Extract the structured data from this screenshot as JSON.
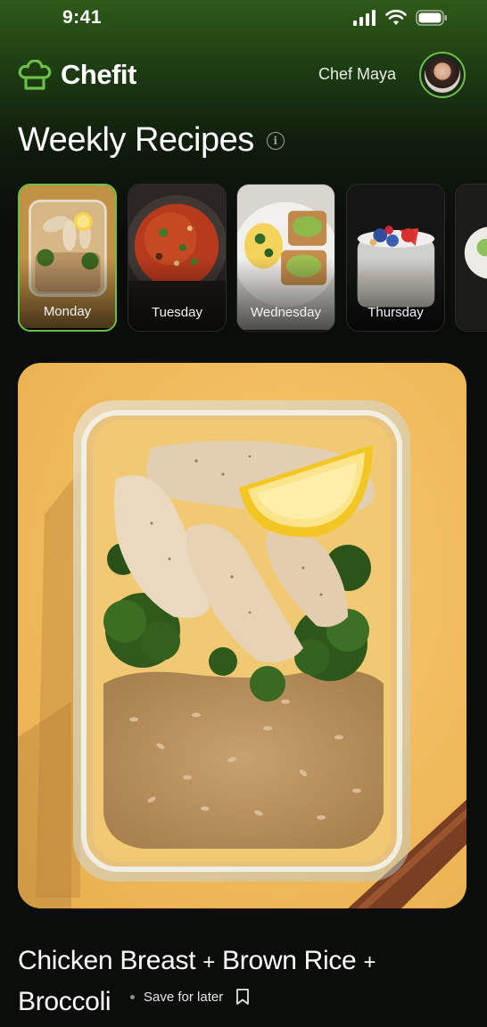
{
  "status_bar": {
    "time": "9:41"
  },
  "header": {
    "app_name": "Chefit",
    "user_name": "Chef Maya"
  },
  "section": {
    "title": "Weekly Recipes"
  },
  "days": [
    {
      "label": "Monday",
      "selected": true
    },
    {
      "label": "Tuesday",
      "selected": false
    },
    {
      "label": "Wednesday",
      "selected": false
    },
    {
      "label": "Thursday",
      "selected": false
    },
    {
      "label": "",
      "selected": false
    }
  ],
  "recipe": {
    "line1_part1": "Chicken Breast",
    "plus1": "+",
    "line1_part2": "Brown Rice",
    "plus2": "+",
    "line2": "Broccoli",
    "save_label": "Save for later"
  },
  "colors": {
    "accent": "#6cc04a",
    "background": "#0b0d0b",
    "hero_bg": "#f1bd5e"
  }
}
